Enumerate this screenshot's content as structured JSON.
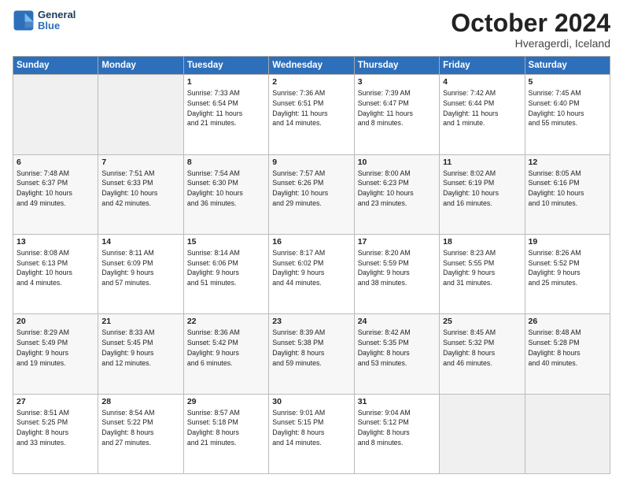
{
  "logo": {
    "line1": "General",
    "line2": "Blue"
  },
  "title": "October 2024",
  "subtitle": "Hveragerdi, Iceland",
  "days_header": [
    "Sunday",
    "Monday",
    "Tuesday",
    "Wednesday",
    "Thursday",
    "Friday",
    "Saturday"
  ],
  "weeks": [
    [
      {
        "day": "",
        "info": ""
      },
      {
        "day": "",
        "info": ""
      },
      {
        "day": "1",
        "info": "Sunrise: 7:33 AM\nSunset: 6:54 PM\nDaylight: 11 hours\nand 21 minutes."
      },
      {
        "day": "2",
        "info": "Sunrise: 7:36 AM\nSunset: 6:51 PM\nDaylight: 11 hours\nand 14 minutes."
      },
      {
        "day": "3",
        "info": "Sunrise: 7:39 AM\nSunset: 6:47 PM\nDaylight: 11 hours\nand 8 minutes."
      },
      {
        "day": "4",
        "info": "Sunrise: 7:42 AM\nSunset: 6:44 PM\nDaylight: 11 hours\nand 1 minute."
      },
      {
        "day": "5",
        "info": "Sunrise: 7:45 AM\nSunset: 6:40 PM\nDaylight: 10 hours\nand 55 minutes."
      }
    ],
    [
      {
        "day": "6",
        "info": "Sunrise: 7:48 AM\nSunset: 6:37 PM\nDaylight: 10 hours\nand 49 minutes."
      },
      {
        "day": "7",
        "info": "Sunrise: 7:51 AM\nSunset: 6:33 PM\nDaylight: 10 hours\nand 42 minutes."
      },
      {
        "day": "8",
        "info": "Sunrise: 7:54 AM\nSunset: 6:30 PM\nDaylight: 10 hours\nand 36 minutes."
      },
      {
        "day": "9",
        "info": "Sunrise: 7:57 AM\nSunset: 6:26 PM\nDaylight: 10 hours\nand 29 minutes."
      },
      {
        "day": "10",
        "info": "Sunrise: 8:00 AM\nSunset: 6:23 PM\nDaylight: 10 hours\nand 23 minutes."
      },
      {
        "day": "11",
        "info": "Sunrise: 8:02 AM\nSunset: 6:19 PM\nDaylight: 10 hours\nand 16 minutes."
      },
      {
        "day": "12",
        "info": "Sunrise: 8:05 AM\nSunset: 6:16 PM\nDaylight: 10 hours\nand 10 minutes."
      }
    ],
    [
      {
        "day": "13",
        "info": "Sunrise: 8:08 AM\nSunset: 6:13 PM\nDaylight: 10 hours\nand 4 minutes."
      },
      {
        "day": "14",
        "info": "Sunrise: 8:11 AM\nSunset: 6:09 PM\nDaylight: 9 hours\nand 57 minutes."
      },
      {
        "day": "15",
        "info": "Sunrise: 8:14 AM\nSunset: 6:06 PM\nDaylight: 9 hours\nand 51 minutes."
      },
      {
        "day": "16",
        "info": "Sunrise: 8:17 AM\nSunset: 6:02 PM\nDaylight: 9 hours\nand 44 minutes."
      },
      {
        "day": "17",
        "info": "Sunrise: 8:20 AM\nSunset: 5:59 PM\nDaylight: 9 hours\nand 38 minutes."
      },
      {
        "day": "18",
        "info": "Sunrise: 8:23 AM\nSunset: 5:55 PM\nDaylight: 9 hours\nand 31 minutes."
      },
      {
        "day": "19",
        "info": "Sunrise: 8:26 AM\nSunset: 5:52 PM\nDaylight: 9 hours\nand 25 minutes."
      }
    ],
    [
      {
        "day": "20",
        "info": "Sunrise: 8:29 AM\nSunset: 5:49 PM\nDaylight: 9 hours\nand 19 minutes."
      },
      {
        "day": "21",
        "info": "Sunrise: 8:33 AM\nSunset: 5:45 PM\nDaylight: 9 hours\nand 12 minutes."
      },
      {
        "day": "22",
        "info": "Sunrise: 8:36 AM\nSunset: 5:42 PM\nDaylight: 9 hours\nand 6 minutes."
      },
      {
        "day": "23",
        "info": "Sunrise: 8:39 AM\nSunset: 5:38 PM\nDaylight: 8 hours\nand 59 minutes."
      },
      {
        "day": "24",
        "info": "Sunrise: 8:42 AM\nSunset: 5:35 PM\nDaylight: 8 hours\nand 53 minutes."
      },
      {
        "day": "25",
        "info": "Sunrise: 8:45 AM\nSunset: 5:32 PM\nDaylight: 8 hours\nand 46 minutes."
      },
      {
        "day": "26",
        "info": "Sunrise: 8:48 AM\nSunset: 5:28 PM\nDaylight: 8 hours\nand 40 minutes."
      }
    ],
    [
      {
        "day": "27",
        "info": "Sunrise: 8:51 AM\nSunset: 5:25 PM\nDaylight: 8 hours\nand 33 minutes."
      },
      {
        "day": "28",
        "info": "Sunrise: 8:54 AM\nSunset: 5:22 PM\nDaylight: 8 hours\nand 27 minutes."
      },
      {
        "day": "29",
        "info": "Sunrise: 8:57 AM\nSunset: 5:18 PM\nDaylight: 8 hours\nand 21 minutes."
      },
      {
        "day": "30",
        "info": "Sunrise: 9:01 AM\nSunset: 5:15 PM\nDaylight: 8 hours\nand 14 minutes."
      },
      {
        "day": "31",
        "info": "Sunrise: 9:04 AM\nSunset: 5:12 PM\nDaylight: 8 hours\nand 8 minutes."
      },
      {
        "day": "",
        "info": ""
      },
      {
        "day": "",
        "info": ""
      }
    ]
  ]
}
